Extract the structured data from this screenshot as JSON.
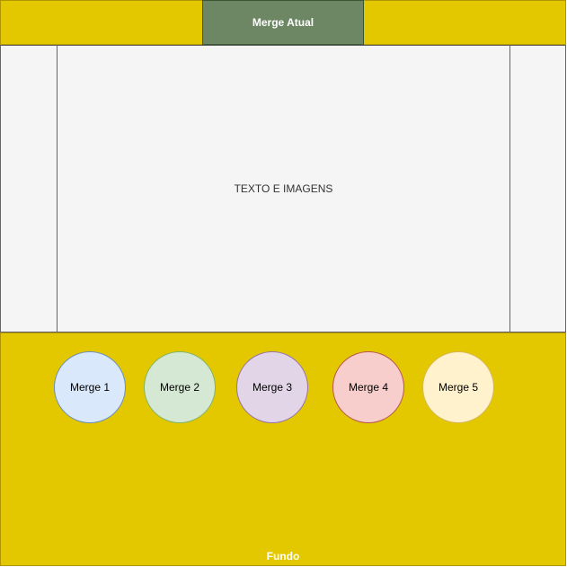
{
  "header": {
    "current_merge_label": "Merge Atual"
  },
  "content": {
    "main_text": "TEXTO E IMAGENS"
  },
  "footer": {
    "label": "Fundo",
    "merges": [
      {
        "label": "Merge 1",
        "fill": "#dae8fc",
        "stroke": "#6c8ebf"
      },
      {
        "label": "Merge 2",
        "fill": "#d5e8d4",
        "stroke": "#82b366"
      },
      {
        "label": "Merge 3",
        "fill": "#e1d5e7",
        "stroke": "#9673a6"
      },
      {
        "label": "Merge 4",
        "fill": "#f8cecc",
        "stroke": "#b85450"
      },
      {
        "label": "Merge 5",
        "fill": "#fff2cc",
        "stroke": "#d6b656"
      }
    ]
  },
  "colors": {
    "accent_yellow": "#e3c800",
    "header_green": "#6d8764",
    "panel_gray": "#f5f5f5"
  }
}
